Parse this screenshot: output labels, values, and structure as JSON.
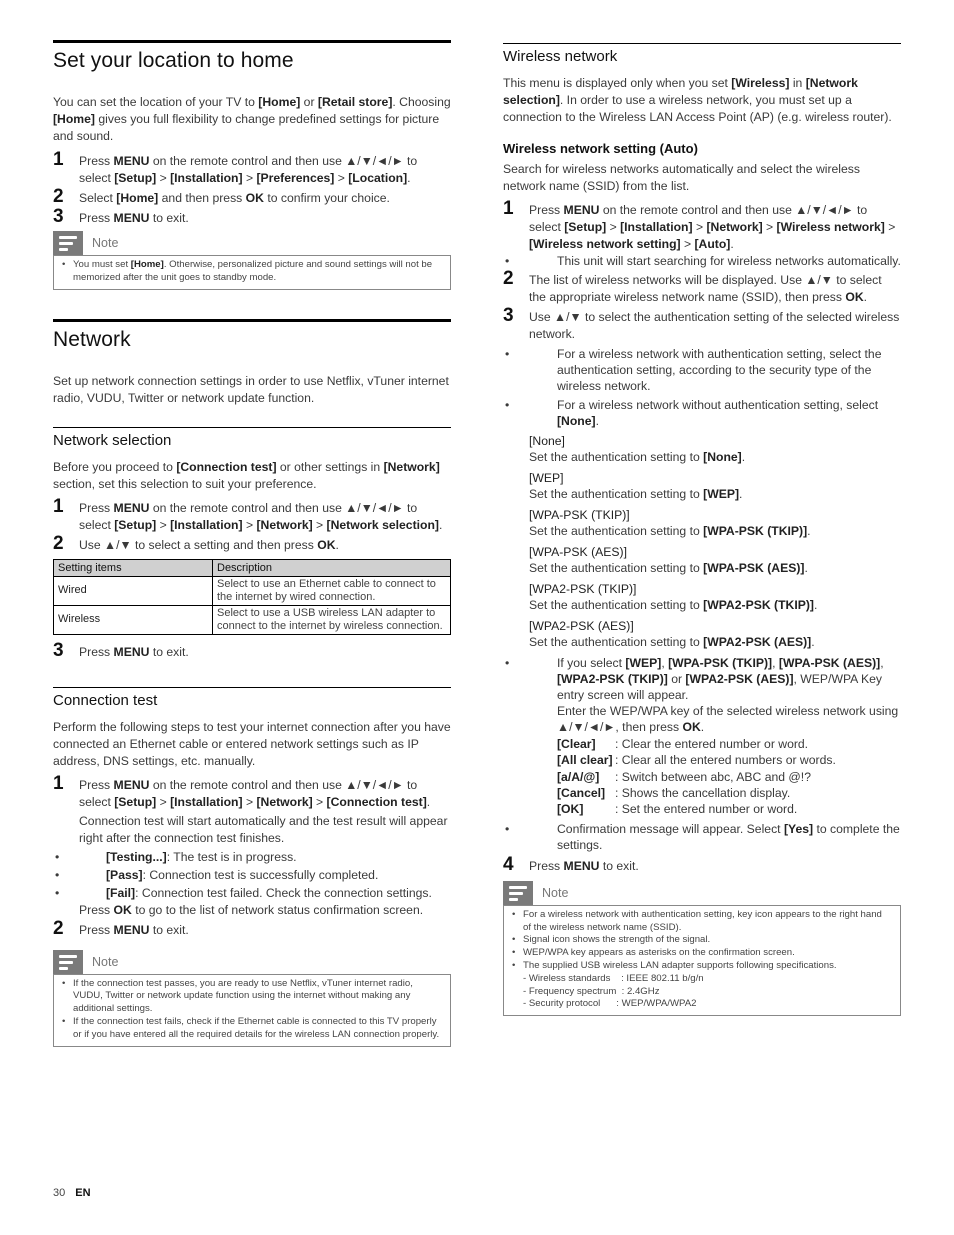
{
  "left": {
    "location": {
      "title": "Set your location to home",
      "intro": [
        "You can set the location of your TV to ",
        "[Home]",
        " or ",
        "[Retail store]",
        ". Choosing ",
        "[Home]",
        " gives you full flexibility to change predefined settings for picture and sound."
      ],
      "steps": [
        {
          "num": "1",
          "parts": [
            "Press ",
            "MENU",
            " on the remote control and then use ▲/▼/◄/► to select ",
            "[Setup]",
            " > ",
            "[Installation]",
            " > ",
            "[Preferences]",
            " > ",
            "[Location]",
            "."
          ]
        },
        {
          "num": "2",
          "parts": [
            "Select ",
            "[Home]",
            " and then press ",
            "OK",
            " to confirm your choice."
          ]
        },
        {
          "num": "3",
          "parts": [
            "Press ",
            "MENU",
            " to exit."
          ]
        }
      ],
      "note_label": "Note",
      "note_items": [
        [
          "You must set ",
          "[Home]",
          ". Otherwise, personalized picture and sound settings will not be memorized after the unit goes to standby mode."
        ]
      ]
    },
    "network": {
      "title": "Network",
      "intro": "Set up network connection settings in order to use Netflix, vTuner internet radio, VUDU, Twitter or network update function."
    },
    "network_selection": {
      "title": "Network selection",
      "intro": [
        "Before you proceed to ",
        "[Connection test]",
        " or other settings in ",
        "[Network]",
        " section, set this selection to suit your preference."
      ],
      "steps": [
        {
          "num": "1",
          "parts": [
            "Press ",
            "MENU",
            " on the remote control and then use ▲/▼/◄/► to select ",
            "[Setup]",
            " > ",
            "[Installation]",
            " > ",
            "[Network]",
            " > ",
            "[Network selection]",
            "."
          ]
        },
        {
          "num": "2",
          "parts": [
            "Use ▲/▼ to select a setting and then press ",
            "OK",
            "."
          ]
        }
      ],
      "table": {
        "headers": [
          "Setting items",
          "Description"
        ],
        "rows": [
          [
            "Wired",
            "Select to use an Ethernet cable to connect to the internet by wired connection."
          ],
          [
            "Wireless",
            "Select to use a USB wireless LAN adapter to connect to the internet by wireless connection."
          ]
        ]
      },
      "step3": {
        "num": "3",
        "parts": [
          "Press ",
          "MENU",
          " to exit."
        ]
      }
    },
    "connection_test": {
      "title": "Connection test",
      "intro": "Perform the following steps to test your internet connection after you have connected an Ethernet cable or entered network settings such as IP address, DNS settings, etc. manually.",
      "step1": {
        "num": "1",
        "parts": [
          "Press ",
          "MENU",
          " on the remote control and then use ▲/▼/◄/► to select ",
          "[Setup]",
          " > ",
          "[Installation]",
          " > ",
          "[Network]",
          " > ",
          "[Connection test]",
          "."
        ]
      },
      "step1_detail": "Connection test will start automatically and the test result will appear right after the connection test finishes.",
      "results": [
        [
          "[Testing...]",
          ": The test is in progress."
        ],
        [
          "[Pass]",
          ": Connection test is successfully completed."
        ],
        [
          "[Fail]",
          ": Connection test failed. Check the connection settings."
        ]
      ],
      "ok_line": [
        "Press ",
        "OK",
        " to go to the list of network status confirmation screen."
      ],
      "step2": {
        "num": "2",
        "parts": [
          "Press ",
          "MENU",
          " to exit."
        ]
      },
      "note_label": "Note",
      "note_items": [
        "If the connection test passes, you are ready to use Netflix, vTuner internet radio, VUDU, Twitter or network update function using the internet without making any additional settings.",
        "If the connection test fails, check if the Ethernet cable is connected to this TV properly or if you have entered all the required details for the wireless LAN connection properly."
      ]
    }
  },
  "right": {
    "wireless": {
      "title": "Wireless network",
      "intro": [
        "This menu is displayed only when you set ",
        "[Wireless]",
        " in ",
        "[Network selection]",
        ". In order to use a wireless network, you must set up a connection to the Wireless LAN Access Point (AP) (e.g. wireless router)."
      ],
      "subtitle": "Wireless network setting (Auto)",
      "sub_intro": "Search for wireless networks automatically and select the wireless network name (SSID) from the list.",
      "step1": {
        "num": "1",
        "parts": [
          "Press ",
          "MENU",
          " on the remote control and then use ▲/▼/◄/► to select ",
          "[Setup]",
          " > ",
          "[Installation]",
          " > ",
          "[Network]",
          " > ",
          "[Wireless network]",
          " > ",
          "[Wireless network setting]",
          " > ",
          "[Auto]",
          "."
        ]
      },
      "step1_bullet": "This unit will start searching for wireless networks automatically.",
      "step2": {
        "num": "2",
        "parts": [
          "The list of wireless networks will be displayed. Use ▲/▼ to select the appropriate wireless network name (SSID), then press ",
          "OK",
          "."
        ]
      },
      "step3": {
        "num": "3",
        "parts": [
          "Use ▲/▼ to select the authentication setting of the selected wireless network."
        ]
      },
      "step3_bullets": [
        [
          "For a wireless network with authentication setting, select the authentication setting, according to the security type of the wireless network."
        ],
        [
          "For a wireless network without authentication setting, select ",
          "[None]",
          "."
        ]
      ],
      "auth_options": [
        {
          "name": "[None]",
          "desc": "Set the authentication setting to ",
          "val": "[None]"
        },
        {
          "name": "[WEP]",
          "desc": "Set the authentication setting to ",
          "val": "[WEP]"
        },
        {
          "name": "[WPA-PSK (TKIP)]",
          "desc": "Set the authentication setting to ",
          "val": "[WPA-PSK (TKIP)]"
        },
        {
          "name": "[WPA-PSK (AES)]",
          "desc": "Set the authentication setting to ",
          "val": "[WPA-PSK (AES)]"
        },
        {
          "name": "[WPA2-PSK (TKIP)]",
          "desc": "Set the authentication setting to ",
          "val": "[WPA2-PSK (TKIP)]"
        },
        {
          "name": "[WPA2-PSK (AES)]",
          "desc": "Set the authentication setting to ",
          "val": "[WPA2-PSK (AES)]"
        }
      ],
      "key_bullet": [
        "If you select ",
        "[WEP]",
        ", ",
        "[WPA-PSK (TKIP)]",
        ", ",
        "[WPA-PSK (AES)]",
        ", ",
        "[WPA2-PSK (TKIP)]",
        " or ",
        "[WPA2-PSK (AES)]",
        ", WEP/WPA Key entry screen will appear."
      ],
      "key_enter": [
        "Enter the WEP/WPA key of the selected wireless network using ▲/▼/◄/►, then press ",
        "OK",
        "."
      ],
      "key_buttons": [
        {
          "key": "[Clear]",
          "desc": ": Clear the entered number or word."
        },
        {
          "key": "[All clear]",
          "desc": ": Clear all the entered numbers or words."
        },
        {
          "key": "[a/A/@]",
          "desc": ": Switch between abc, ABC and @!?"
        },
        {
          "key": "[Cancel]",
          "desc": ": Shows the cancellation display."
        },
        {
          "key": "[OK]",
          "desc": ": Set the entered number or word."
        }
      ],
      "confirm_bullet": [
        "Confirmation message will appear. Select ",
        "[Yes]",
        " to complete the settings."
      ],
      "step4": {
        "num": "4",
        "parts": [
          "Press ",
          "MENU",
          " to exit."
        ]
      },
      "note_label": "Note",
      "note_items": [
        "For a wireless network with authentication setting, key icon appears to the right hand of the wireless network name (SSID).",
        "Signal icon shows the strength of the signal.",
        "WEP/WPA key appears as asterisks on the confirmation screen.",
        "The supplied USB wireless LAN adapter supports following specifications."
      ],
      "specs": [
        "- Wireless standards    : IEEE 802.11 b/g/n",
        "- Frequency spectrum  : 2.4GHz",
        "- Security protocol      : WEP/WPA/WPA2"
      ]
    }
  },
  "footer": {
    "page": "30",
    "lang": "EN"
  }
}
